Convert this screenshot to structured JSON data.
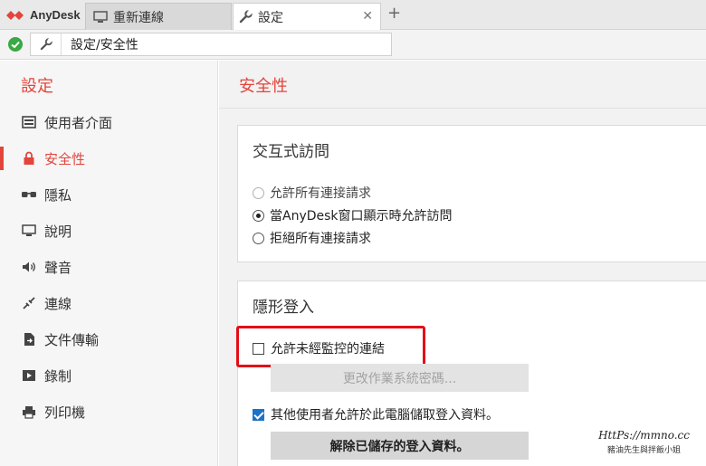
{
  "app": {
    "name": "AnyDesk",
    "brand_color": "#e2453c"
  },
  "tabs": [
    {
      "label": "重新連線",
      "icon": "monitor-icon"
    },
    {
      "label": "設定",
      "icon": "wrench-icon",
      "close": "✕"
    }
  ],
  "tab_add": "+",
  "address": {
    "status": "connected",
    "status_color": "#3aa845",
    "icon": "wrench-icon",
    "text": "設定/安全性"
  },
  "sidebar": {
    "title": "設定",
    "items": [
      {
        "label": "使用者介面",
        "icon": "interface-icon",
        "active": false
      },
      {
        "label": "安全性",
        "icon": "lock-icon",
        "active": true
      },
      {
        "label": "隱私",
        "icon": "glasses-icon",
        "active": false
      },
      {
        "label": "說明",
        "icon": "monitor-icon",
        "active": false
      },
      {
        "label": "聲音",
        "icon": "speaker-icon",
        "active": false
      },
      {
        "label": "連線",
        "icon": "connection-icon",
        "active": false
      },
      {
        "label": "文件傳輸",
        "icon": "file-transfer-icon",
        "active": false
      },
      {
        "label": "錄制",
        "icon": "record-icon",
        "active": false
      },
      {
        "label": "列印機",
        "icon": "printer-icon",
        "active": false
      }
    ]
  },
  "main": {
    "title": "安全性",
    "interactive_access": {
      "title": "交互式訪問",
      "options": [
        {
          "label": "允許所有連接請求",
          "selected": false,
          "enabled": false
        },
        {
          "label": "當AnyDesk窗口顯示時允許訪問",
          "selected": true,
          "enabled": true
        },
        {
          "label": "拒絕所有連接請求",
          "selected": false,
          "enabled": true
        }
      ]
    },
    "invisible_login": {
      "title": "隱形登入",
      "unattended_label": "允許未經監控的連結",
      "unattended_checked": false,
      "change_password_button": "更改作業系統密碼...",
      "other_users_label": "其他使用者允許於此電腦儲取登入資料。",
      "other_users_checked": true,
      "clear_button": "解除已儲存的登入資料。"
    }
  },
  "watermark": {
    "line1": "HttPs://mmno.cc",
    "line2": "豬油先生與拌飯小姐"
  }
}
